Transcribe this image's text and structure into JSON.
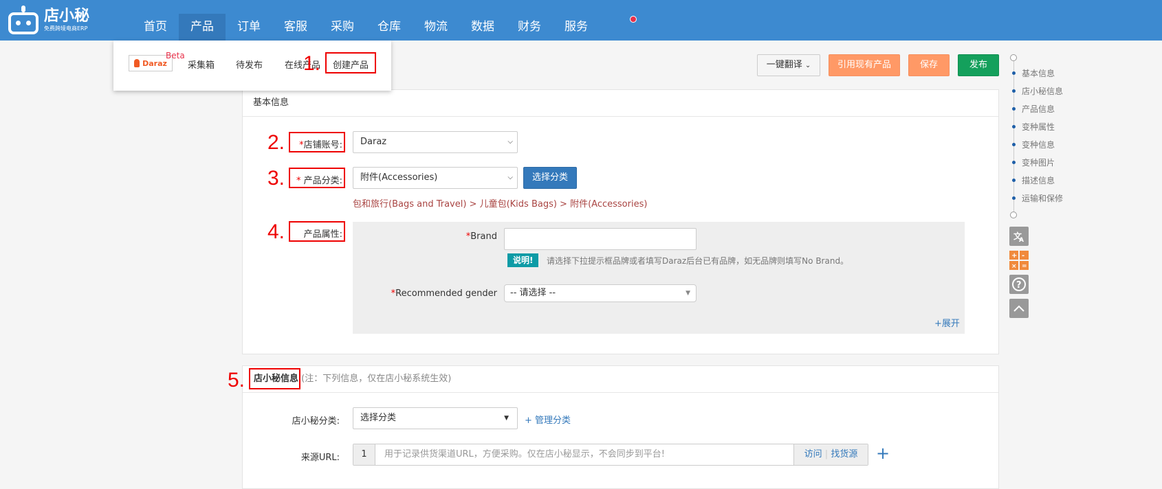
{
  "header": {
    "logo_main": "店小秘",
    "logo_sub": "免费跨境电商ERP",
    "nav": [
      "首页",
      "产品",
      "订单",
      "客服",
      "采购",
      "仓库",
      "物流",
      "数据",
      "财务",
      "服务"
    ],
    "active_nav": "产品"
  },
  "dropdown": {
    "platform": "Daraz",
    "beta": "Beta",
    "items": [
      "采集箱",
      "待发布",
      "在线产品",
      "创建产品"
    ]
  },
  "annotations": [
    "1.",
    "2.",
    "3.",
    "4.",
    "5."
  ],
  "toolbar": {
    "translate": "一键翻译",
    "quote": "引用现有产品",
    "save": "保存",
    "publish": "发布"
  },
  "basic": {
    "title": "基本信息",
    "shop_label": "店铺账号:",
    "shop_value": "Daraz",
    "category_label": "产品分类:",
    "category_value": "附件(Accessories)",
    "choose_category": "选择分类",
    "breadcrumb": "包和旅行(Bags and Travel) > 儿童包(Kids Bags) > 附件(Accessories)",
    "attr_label": "产品属性:",
    "brand_label": "Brand",
    "brand_value": "",
    "tip_badge": "说明!",
    "tip_text": "请选择下拉提示框品牌或者填写Daraz后台已有品牌，如无品牌则填写No Brand。",
    "gender_label": "Recommended gender",
    "gender_value": "-- 请选择 --",
    "expand": "+展开"
  },
  "dxm": {
    "title": "店小秘信息",
    "note": "(注：下列信息，仅在店小秘系统生效)",
    "category_label": "店小秘分类:",
    "category_value": "选择分类",
    "manage": "+ 管理分类",
    "url_label": "来源URL:",
    "url_index": "1",
    "url_placeholder": "用于记录供货渠道URL，方便采购。仅在店小秘显示，不会同步到平台!",
    "visit": "访问",
    "find_source": "找货源",
    "add": "+"
  },
  "sidenav": {
    "items": [
      "基本信息",
      "店小秘信息",
      "产品信息",
      "变种属性",
      "变种信息",
      "变种图片",
      "描述信息",
      "运输和保修"
    ]
  }
}
